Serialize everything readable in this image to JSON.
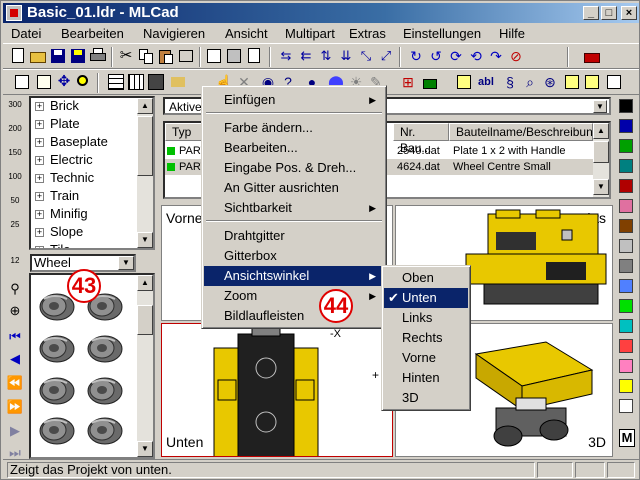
{
  "window": {
    "title": "Basic_01.ldr - MLCad"
  },
  "title_buttons": [
    "_",
    "□",
    "×"
  ],
  "menubar": [
    "Datei",
    "Bearbeiten",
    "Navigieren",
    "Ansicht",
    "Multipart",
    "Extras",
    "Einstellungen",
    "Hilfe"
  ],
  "left_toolbar": [
    "300",
    "200",
    "150",
    "100",
    "50",
    "25",
    "12"
  ],
  "tree": [
    "Brick",
    "Plate",
    "Baseplate",
    "Electric",
    "Technic",
    "Train",
    "Minifig",
    "Slope",
    "Tile"
  ],
  "category_combo": "Wheel",
  "list": {
    "active_label": "Aktive",
    "headers": [
      "Typ",
      "Nr. Bau...",
      "Bauteilname/Beschreibung"
    ],
    "rows": [
      {
        "typ": "PART",
        "nr": "2540.dat",
        "desc": "Plate 1 x 2 with Handle"
      },
      {
        "typ": "PART",
        "nr": "4624.dat",
        "desc": "Wheel Centre Small"
      }
    ]
  },
  "views": {
    "front": "Vorne",
    "right": "Rechts",
    "bottom": "Unten",
    "threed": "3D"
  },
  "axis": {
    "x": "-X",
    "plus": "+"
  },
  "context_menu": {
    "items": [
      {
        "label": "Einfügen",
        "submenu": true
      },
      {
        "label": "Farbe ändern...",
        "submenu": false
      },
      {
        "label": "Bearbeiten...",
        "submenu": false
      },
      {
        "label": "Eingabe Pos. & Dreh...",
        "submenu": false
      },
      {
        "label": "An Gitter ausrichten",
        "submenu": false
      },
      {
        "label": "Sichtbarkeit",
        "submenu": true
      },
      {
        "label": "Drahtgitter",
        "submenu": false
      },
      {
        "label": "Gitterbox",
        "submenu": false
      },
      {
        "label": "Ansichtswinkel",
        "submenu": true
      },
      {
        "label": "Zoom",
        "submenu": true
      },
      {
        "label": "Bildlaufleisten",
        "submenu": false
      }
    ],
    "highlighted": "Ansichtswinkel"
  },
  "submenu": {
    "items": [
      "Oben",
      "Unten",
      "Links",
      "Rechts",
      "Vorne",
      "Hinten",
      "3D"
    ],
    "checked": "Unten"
  },
  "callouts": [
    "43",
    "44"
  ],
  "palette_colors": [
    "#000000",
    "#0000aa",
    "#00a000",
    "#008080",
    "#b00000",
    "#e070a0",
    "#804000",
    "#c0c0c0",
    "#808080",
    "#5080ff",
    "#00e000",
    "#00c0c0",
    "#ff4040",
    "#ff80c0",
    "#ffff00",
    "#ffffff"
  ],
  "palette_label": "M",
  "status": {
    "text": "Zeigt das Projekt von unten."
  }
}
